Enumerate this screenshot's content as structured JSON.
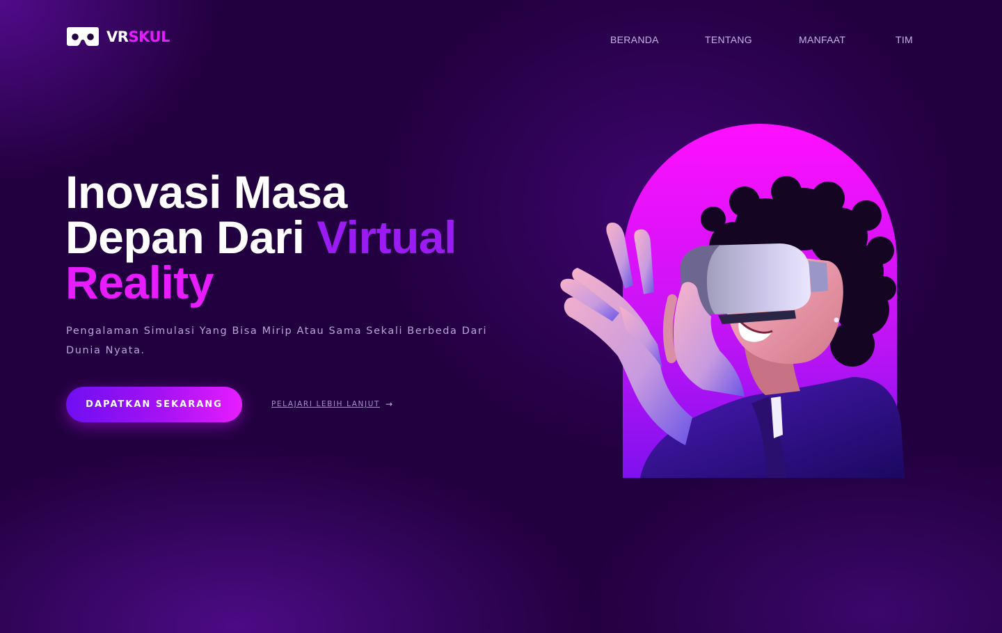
{
  "header": {
    "logo": {
      "part1": "VR",
      "part2": "SKUL"
    },
    "nav": [
      {
        "label": "BERANDA"
      },
      {
        "label": "TENTANG"
      },
      {
        "label": "MANFAAT"
      },
      {
        "label": "TIM"
      }
    ]
  },
  "hero": {
    "title_line1": "Inovasi Masa",
    "title_line2_a": "Depan Dari ",
    "title_line2_b": "Virtual",
    "title_line3": "Reality",
    "subtitle": "Pengalaman Simulasi Yang Bisa Mirip Atau Sama Sekali Berbeda Dari Dunia Nyata.",
    "cta_label": "DAPATKAN SEKARANG",
    "learn_more_label": "PELAJARI LEBIH LANJUT",
    "learn_more_icon": "arrow-right-icon",
    "image_icon": "vr-person-illustration"
  },
  "colors": {
    "background": "#22003f",
    "accent_purple": "#9b1bf3",
    "accent_magenta": "#e81dff",
    "nav_text": "#c9b2e6"
  }
}
